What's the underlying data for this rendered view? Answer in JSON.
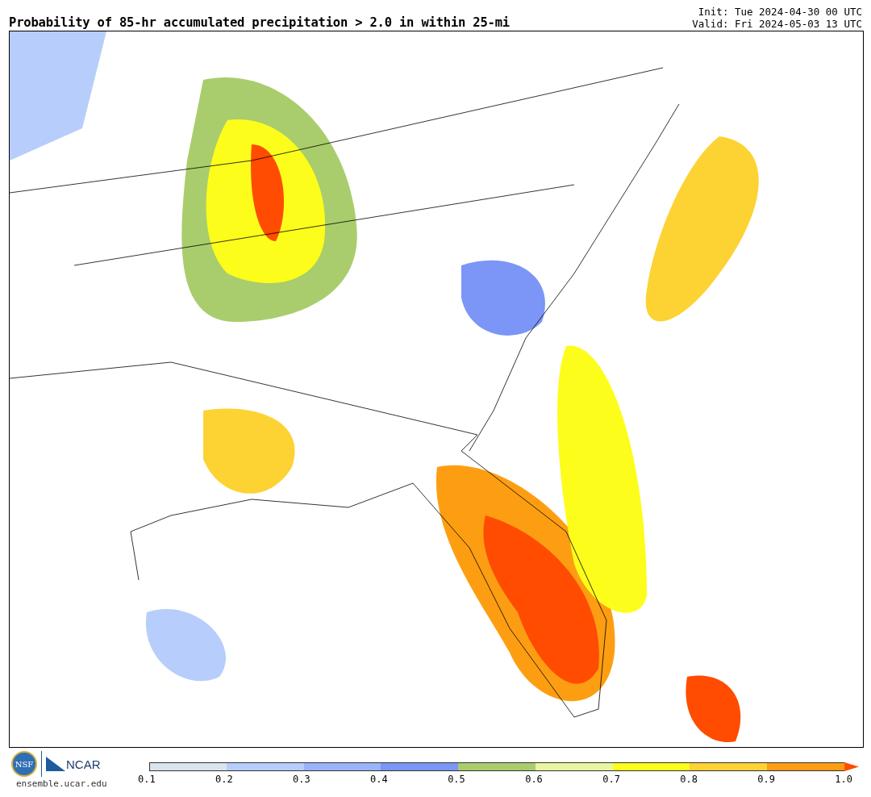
{
  "title": "Probability of 85-hr accumulated precipitation > 2.0 in within 25-mi",
  "init": "Init: Tue 2024-04-30 00 UTC",
  "valid": "Valid: Fri 2024-05-03 13 UTC",
  "logos": {
    "nsf": "NSF",
    "ncar": "NCAR",
    "url": "ensemble.ucar.edu"
  },
  "colorbar": {
    "segments": [
      {
        "color": "#d9e4ee"
      },
      {
        "color": "#b7cdfb"
      },
      {
        "color": "#98b4fa"
      },
      {
        "color": "#7b96f7"
      },
      {
        "color": "#a9cd6c"
      },
      {
        "color": "#e9f5a2"
      },
      {
        "color": "#fdfd1c"
      },
      {
        "color": "#fdd233"
      },
      {
        "color": "#fd9e12"
      }
    ],
    "over": {
      "color": "#ff4c00"
    },
    "ticks": [
      "0.1",
      "0.2",
      "0.3",
      "0.4",
      "0.5",
      "0.6",
      "0.7",
      "0.8",
      "0.9",
      "1.0"
    ]
  }
}
